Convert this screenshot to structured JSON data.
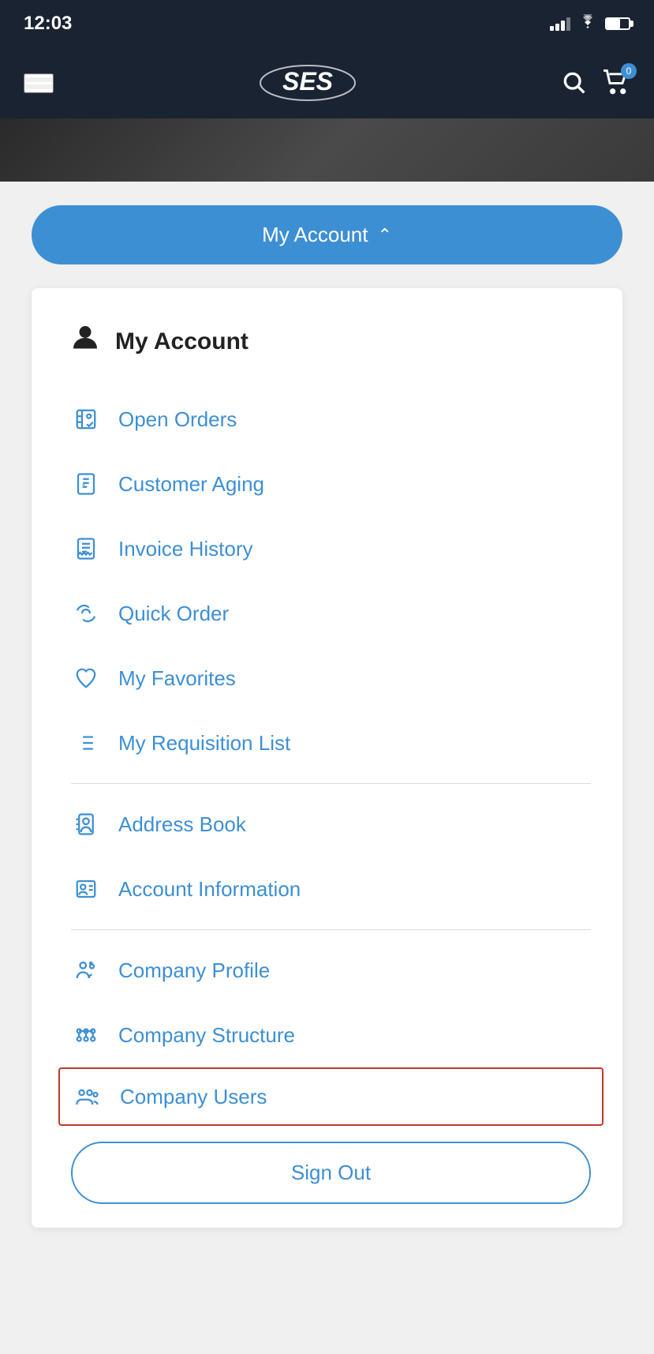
{
  "statusBar": {
    "time": "12:03",
    "cartCount": "0"
  },
  "header": {
    "logoAlt": "SES",
    "menuLabel": "Menu",
    "searchLabel": "Search",
    "cartLabel": "Cart"
  },
  "myAccountButton": {
    "label": "My Account",
    "chevron": "^"
  },
  "menu": {
    "header": {
      "title": "My Account"
    },
    "items": [
      {
        "id": "open-orders",
        "label": "Open Orders",
        "icon": "cart-icon"
      },
      {
        "id": "customer-aging",
        "label": "Customer Aging",
        "icon": "document-dollar-icon"
      },
      {
        "id": "invoice-history",
        "label": "Invoice History",
        "icon": "invoice-icon"
      },
      {
        "id": "quick-order",
        "label": "Quick Order",
        "icon": "quick-order-icon"
      },
      {
        "id": "my-favorites",
        "label": "My Favorites",
        "icon": "heart-icon"
      },
      {
        "id": "requisition-list",
        "label": "My Requisition List",
        "icon": "list-icon"
      }
    ],
    "secondGroup": [
      {
        "id": "address-book",
        "label": "Address Book",
        "icon": "address-book-icon"
      },
      {
        "id": "account-information",
        "label": "Account Information",
        "icon": "account-info-icon"
      }
    ],
    "thirdGroup": [
      {
        "id": "company-profile",
        "label": "Company Profile",
        "icon": "company-profile-icon"
      },
      {
        "id": "company-structure",
        "label": "Company Structure",
        "icon": "company-structure-icon"
      },
      {
        "id": "company-users",
        "label": "Company Users",
        "icon": "company-users-icon"
      }
    ],
    "signOut": "Sign Out"
  }
}
